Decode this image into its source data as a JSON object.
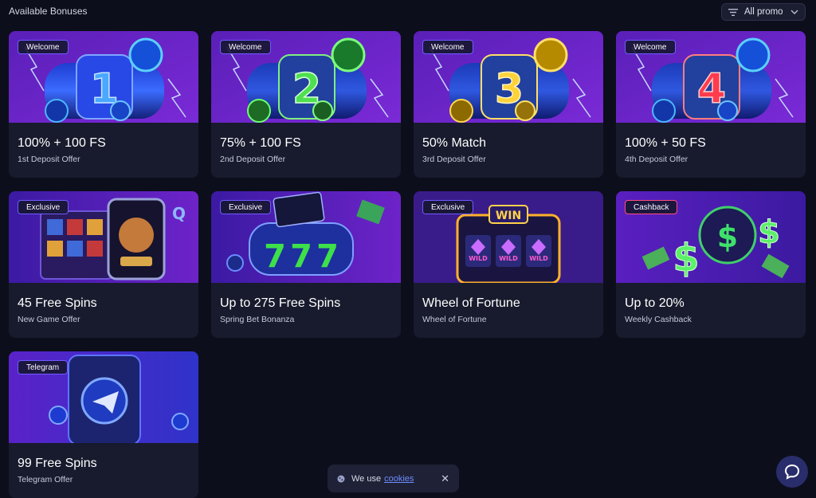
{
  "header": {
    "title": "Available Bonuses",
    "filter_label": "All promo"
  },
  "cards": [
    {
      "badge": "Welcome",
      "title": "100% + 100 FS",
      "subtitle": "1st Deposit Offer",
      "art": "slot-number-1"
    },
    {
      "badge": "Welcome",
      "title": "75% + 100 FS",
      "subtitle": "2nd Deposit Offer",
      "art": "slot-number-2"
    },
    {
      "badge": "Welcome",
      "title": "50% Match",
      "subtitle": "3rd Deposit Offer",
      "art": "slot-number-3"
    },
    {
      "badge": "Welcome",
      "title": "100% + 50 FS",
      "subtitle": "4th Deposit Offer",
      "art": "slot-number-4"
    },
    {
      "badge": "Exclusive",
      "title": "45 Free Spins",
      "subtitle": "New Game Offer",
      "art": "phone-slot-game"
    },
    {
      "badge": "Exclusive",
      "title": "Up to 275 Free Spins",
      "subtitle": "Spring Bet Bonanza",
      "art": "slot-777"
    },
    {
      "badge": "Exclusive",
      "title": "Wheel of Fortune",
      "subtitle": "Wheel of Fortune",
      "art": "win-slot-machine"
    },
    {
      "badge": "Cashback",
      "title": "Up to 20%",
      "subtitle": "Weekly Cashback",
      "art": "cashback-dollars"
    },
    {
      "badge": "Telegram",
      "title": "99 Free Spins",
      "subtitle": "Telegram Offer",
      "art": "telegram-phone"
    }
  ],
  "art_text": {
    "n1": "1",
    "n2": "2",
    "n3": "3",
    "n4": "4",
    "seven": "7",
    "win": "WIN",
    "wild": "WILD",
    "dollar": "$"
  },
  "cookie": {
    "prefix": "We use",
    "link": "cookies",
    "close": "✕"
  },
  "icons": {
    "filter": "filter-lines-icon",
    "chevron": "chevron-down-icon",
    "cookie": "cookie-icon",
    "chat": "chat-bubble-icon"
  },
  "colors": {
    "background": "#0c0e1b",
    "card": "#181b2d",
    "badge_border": "#6e5cff",
    "cashback_badge_border": "#ff4f7a",
    "link": "#6f8bff"
  }
}
